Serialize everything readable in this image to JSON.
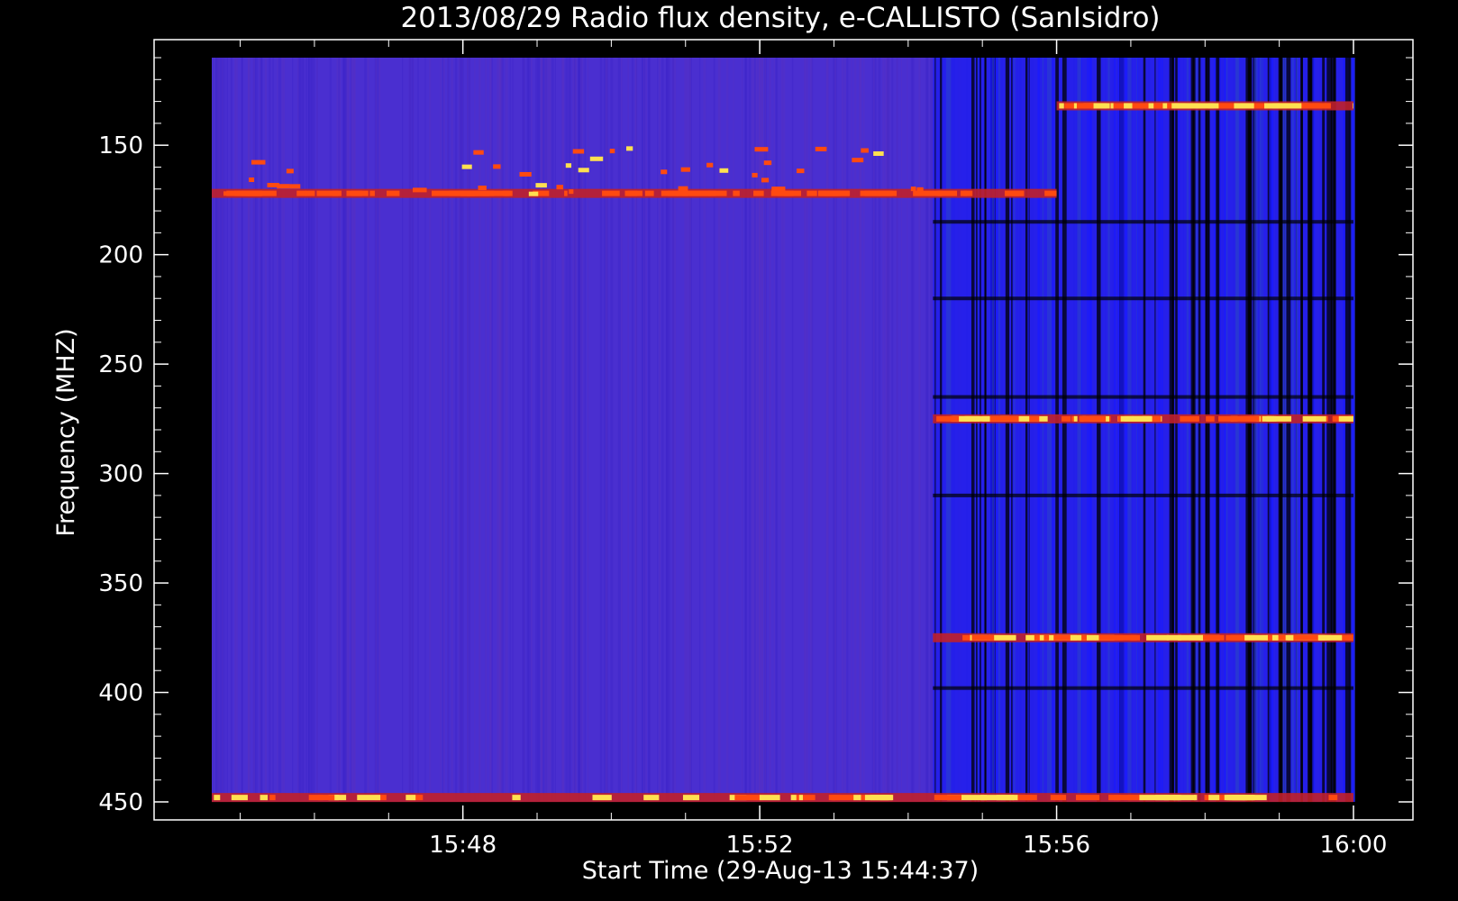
{
  "chart_data": {
    "type": "heatmap",
    "title": "2013/08/29  Radio flux density, e-CALLISTO (SanIsidro)",
    "xlabel": "Start Time (29-Aug-13 15:44:37)",
    "ylabel": "Frequency (MHZ)",
    "xlim": [
      "15:44:37",
      "16:00:00"
    ],
    "ylim": [
      450,
      110
    ],
    "x_ticks": [
      "15:48",
      "15:52",
      "15:56",
      "16:00"
    ],
    "y_ticks": [
      150,
      200,
      250,
      300,
      350,
      400,
      450
    ],
    "colormap": [
      "#000000",
      "#1a1aff",
      "#4b2bd6",
      "#c0202a",
      "#ff4a10",
      "#ffe050"
    ],
    "background_level_color": "#4a2fd0",
    "features": [
      {
        "type": "interference-band",
        "freq_mhz": 172,
        "start": "15:44:37",
        "end": "15:56:00",
        "intensity": "medium"
      },
      {
        "type": "interference-band",
        "freq_mhz": 448,
        "start": "15:44:37",
        "end": "16:00:00",
        "intensity": "high"
      },
      {
        "type": "interference-band",
        "freq_mhz": 132,
        "start": "15:56:00",
        "end": "16:00:00",
        "intensity": "high"
      },
      {
        "type": "interference-band",
        "freq_mhz": 275,
        "start": "15:54:20",
        "end": "16:00:00",
        "intensity": "high"
      },
      {
        "type": "interference-band",
        "freq_mhz": 375,
        "start": "15:54:20",
        "end": "16:00:00",
        "intensity": "high"
      },
      {
        "type": "noisy-region",
        "start": "15:54:20",
        "end": "16:00:00"
      }
    ]
  }
}
